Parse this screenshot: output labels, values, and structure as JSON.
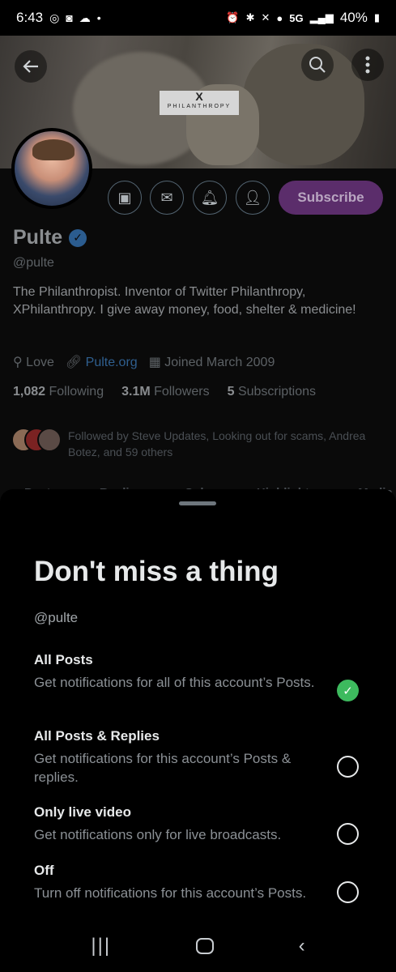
{
  "status_bar": {
    "time": "6:43",
    "network": "5G",
    "battery": "40%"
  },
  "profile": {
    "banner_badge_x": "X",
    "banner_badge_text": "PHILANTHROPY",
    "subscribe_label": "Subscribe",
    "name": "Pulte",
    "handle": "@pulte",
    "bio": "The Philanthropist. Inventor of Twitter Philanthropy, XPhilanthropy. I give away money, food, shelter & medicine!",
    "location": "Love",
    "website": "Pulte.org",
    "joined": "Joined March 2009",
    "following_count": "1,082",
    "following_label": "Following",
    "followers_count": "3.1M",
    "followers_label": "Followers",
    "subscriptions_count": "5",
    "subscriptions_label": "Subscriptions",
    "followed_by": "Followed by Steve Updates, Looking out for scams, Andrea Botez, and 59 others",
    "tabs": [
      "Posts",
      "Replies",
      "Subs",
      "Highlights",
      "Media"
    ]
  },
  "sheet": {
    "title": "Don't miss a thing",
    "handle": "@pulte",
    "options": [
      {
        "title": "All Posts",
        "desc": "Get notifications for all of this account’s Posts.",
        "selected": true
      },
      {
        "title": "All Posts & Replies",
        "desc": "Get notifications for this account’s Posts & replies.",
        "selected": false
      },
      {
        "title": "Only live video",
        "desc": "Get notifications only for live broadcasts.",
        "selected": false
      },
      {
        "title": "Off",
        "desc": "Turn off notifications for this account’s Posts.",
        "selected": false
      }
    ]
  },
  "icons": {
    "back": "arrow-left-icon",
    "search": "search-icon",
    "more": "more-vertical-icon",
    "checkmark": "✓"
  },
  "colors": {
    "accent_check": "#3dba5e",
    "subscribe_bg": "#5b2d6b",
    "link": "#2f5f8f"
  }
}
